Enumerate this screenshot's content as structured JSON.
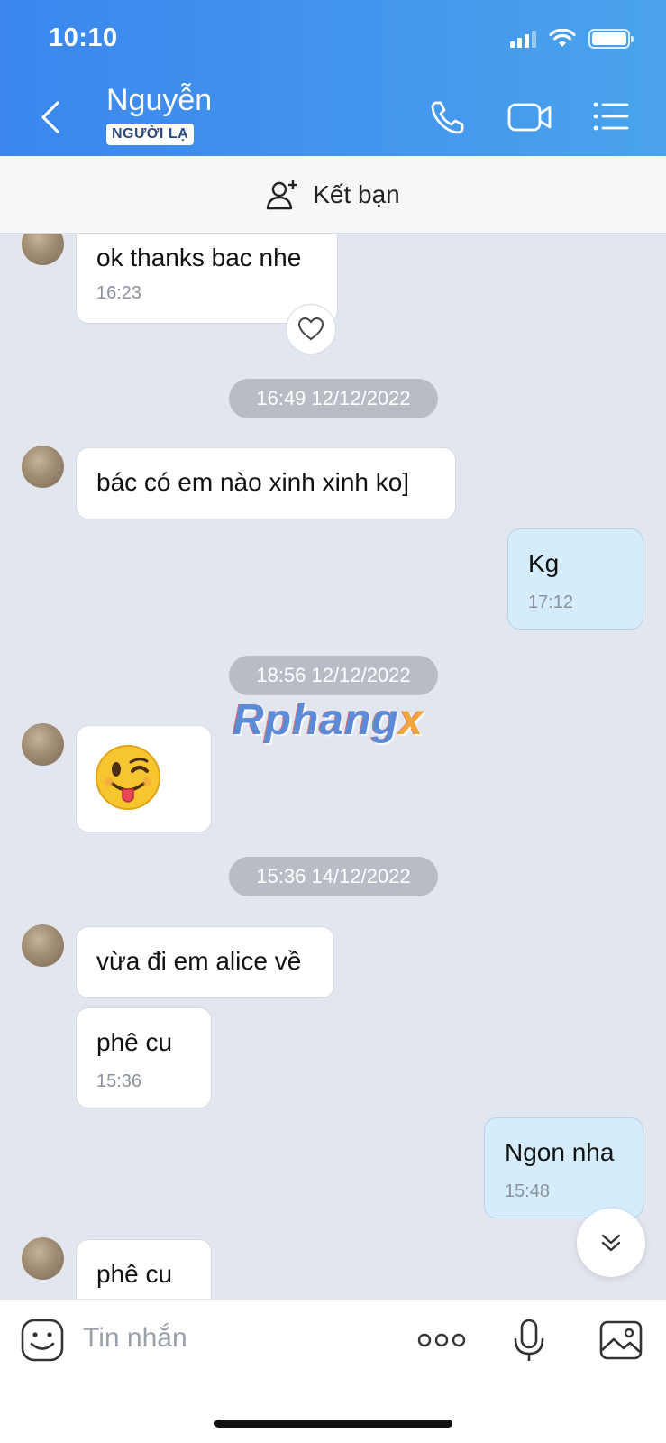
{
  "status": {
    "time": "10:10"
  },
  "header": {
    "contact_name": "Nguyễn",
    "badge": "NGƯỜI LẠ"
  },
  "friend_bar": {
    "label": "Kết bạn"
  },
  "chat": {
    "dates": [
      "16:49 12/12/2022",
      "18:56 12/12/2022",
      "15:36 14/12/2022"
    ],
    "messages": [
      {
        "text": "ok thanks bac nhe",
        "time": "16:23"
      },
      {
        "text": "bác có em nào xinh xinh ko]"
      },
      {
        "text": "Kg",
        "time": "17:12"
      },
      {
        "sticker": "winking-tongue-emoji"
      },
      {
        "text": "vừa đi em alice về"
      },
      {
        "text": "phê cu",
        "time": "15:36"
      },
      {
        "text": "Ngon nha",
        "time": "15:48"
      },
      {
        "text": "phê cu"
      }
    ]
  },
  "watermark": {
    "main": "Rphang",
    "accent": "x"
  },
  "input": {
    "placeholder": "Tin nhắn"
  },
  "colors": {
    "header_start": "#3a86ee",
    "header_end": "#4aa3ec",
    "outgoing_bubble": "#d4ecfb",
    "chat_bg": "#e2e7ef"
  }
}
